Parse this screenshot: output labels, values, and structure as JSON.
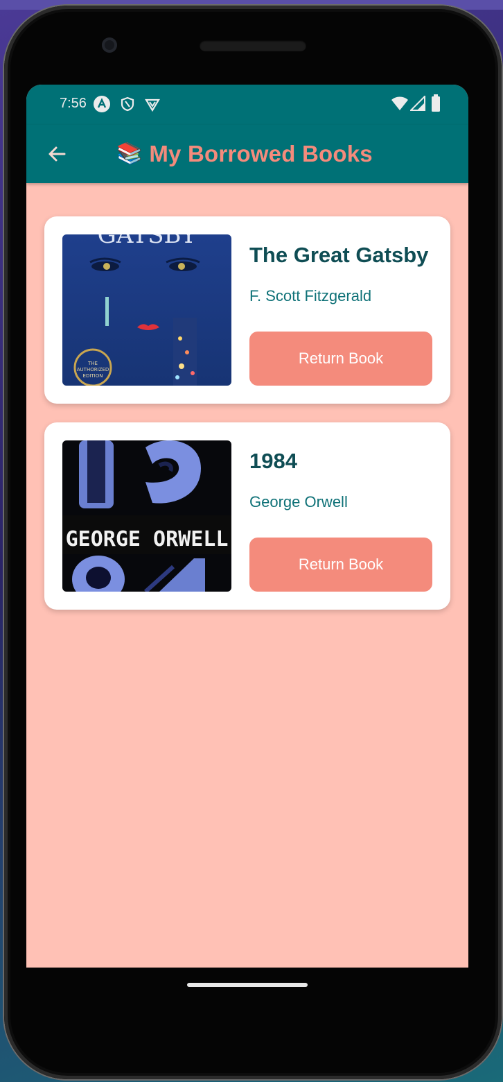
{
  "status_bar": {
    "time": "7:56",
    "left_icons": [
      "app-notification-icon",
      "shield-icon",
      "vpn-icon"
    ],
    "right_icons": [
      "wifi-icon",
      "cell-signal-icon",
      "battery-icon"
    ]
  },
  "app_bar": {
    "title_emoji": "📚",
    "title": "My Borrowed Books",
    "back_icon": "arrow-back-icon"
  },
  "books": [
    {
      "title": "The Great Gatsby",
      "author": "F. Scott Fitzgerald",
      "action_label": "Return Book",
      "cover": {
        "text_top": "GATSBY",
        "badge": "THE AUTHORIZED EDITION"
      }
    },
    {
      "title": "1984",
      "author": "George Orwell",
      "action_label": "Return Book",
      "cover": {
        "text": "GEORGE ORWELL"
      }
    }
  ],
  "colors": {
    "primary": "#007176",
    "accent": "#f48b7c",
    "background": "#ffc1b5",
    "title_text": "#0f4d54",
    "author_text": "#0e7177"
  }
}
